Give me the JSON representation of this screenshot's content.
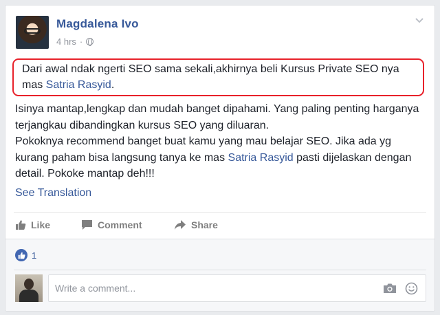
{
  "post": {
    "author": "Magdalena Ivo",
    "time": "4 hrs",
    "separator": "·",
    "privacy_icon": "globe-icon",
    "highlight_text_1": "Dari awal ndak ngerti SEO sama sekali,akhirnya beli Kursus Private SEO nya mas ",
    "highlight_link": "Satria Rasyid",
    "highlight_text_2": ".",
    "body_text_1": "Isinya mantap,lengkap dan mudah banget dipahami. Yang paling penting harganya terjangkau dibandingkan kursus SEO yang diluaran.",
    "body_text_2": "Pokoknya recommend banget buat kamu yang mau belajar SEO. Jika ada yg kurang paham bisa langsung tanya ke mas ",
    "body_link": "Satria Rasyid",
    "body_text_3": " pasti dijelaskan dengan detail. Pokoke mantap deh!!!",
    "see_translation": "See Translation"
  },
  "actions": {
    "like": "Like",
    "comment": "Comment",
    "share": "Share"
  },
  "reactions": {
    "count": "1",
    "icon": "thumbs-up-icon"
  },
  "comment_box": {
    "placeholder": "Write a comment..."
  },
  "colors": {
    "link": "#365899",
    "highlight_border": "#e8212a",
    "like_badge": "#4267b2"
  }
}
